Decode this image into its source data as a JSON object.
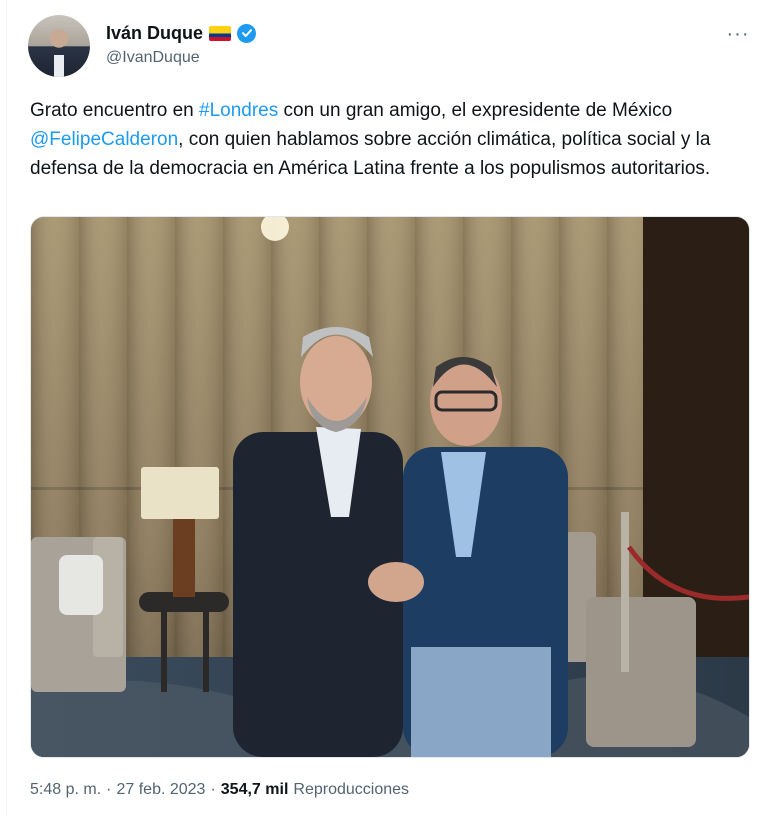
{
  "author": {
    "display_name": "Iván Duque",
    "handle": "@IvanDuque",
    "flag_icon": "colombia-flag-icon",
    "verified_icon": "verified-badge-icon"
  },
  "menu": {
    "more_label": "···"
  },
  "tweet": {
    "text_1": "Grato encuentro en ",
    "hashtag": "#Londres",
    "text_2": " con un gran amigo, el expresidente de México ",
    "mention": "@FelipeCalderon",
    "text_3": ", con quien hablamos sobre acción climática, política social y la defensa de la democracia en América Latina frente a los populismos autoritarios."
  },
  "meta": {
    "time": "5:48 p. m.",
    "separator": "·",
    "date": "27 feb. 2023",
    "views_count": "354,7 mil",
    "views_label": "Reproducciones"
  },
  "colors": {
    "link": "#1d9bf0",
    "secondary_text": "#536471",
    "primary_text": "#0f1419",
    "verified": "#1d9bf0"
  }
}
